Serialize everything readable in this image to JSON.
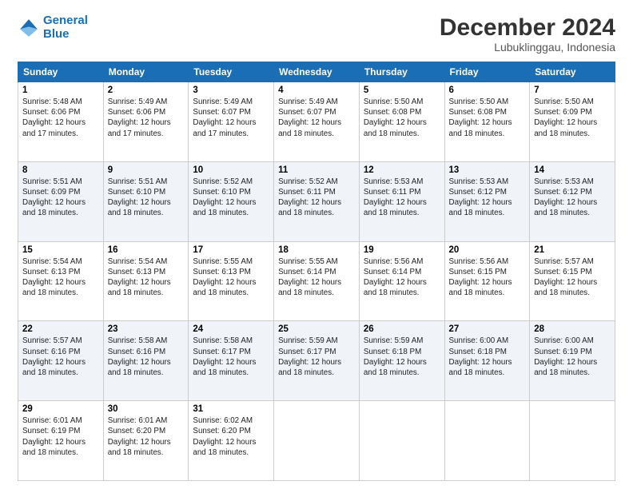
{
  "header": {
    "logo_line1": "General",
    "logo_line2": "Blue",
    "title": "December 2024",
    "subtitle": "Lubuklinggau, Indonesia"
  },
  "days_of_week": [
    "Sunday",
    "Monday",
    "Tuesday",
    "Wednesday",
    "Thursday",
    "Friday",
    "Saturday"
  ],
  "weeks": [
    [
      {
        "day": "1",
        "info": "Sunrise: 5:48 AM\nSunset: 6:06 PM\nDaylight: 12 hours and 17 minutes."
      },
      {
        "day": "2",
        "info": "Sunrise: 5:49 AM\nSunset: 6:06 PM\nDaylight: 12 hours and 17 minutes."
      },
      {
        "day": "3",
        "info": "Sunrise: 5:49 AM\nSunset: 6:07 PM\nDaylight: 12 hours and 17 minutes."
      },
      {
        "day": "4",
        "info": "Sunrise: 5:49 AM\nSunset: 6:07 PM\nDaylight: 12 hours and 18 minutes."
      },
      {
        "day": "5",
        "info": "Sunrise: 5:50 AM\nSunset: 6:08 PM\nDaylight: 12 hours and 18 minutes."
      },
      {
        "day": "6",
        "info": "Sunrise: 5:50 AM\nSunset: 6:08 PM\nDaylight: 12 hours and 18 minutes."
      },
      {
        "day": "7",
        "info": "Sunrise: 5:50 AM\nSunset: 6:09 PM\nDaylight: 12 hours and 18 minutes."
      }
    ],
    [
      {
        "day": "8",
        "info": "Sunrise: 5:51 AM\nSunset: 6:09 PM\nDaylight: 12 hours and 18 minutes."
      },
      {
        "day": "9",
        "info": "Sunrise: 5:51 AM\nSunset: 6:10 PM\nDaylight: 12 hours and 18 minutes."
      },
      {
        "day": "10",
        "info": "Sunrise: 5:52 AM\nSunset: 6:10 PM\nDaylight: 12 hours and 18 minutes."
      },
      {
        "day": "11",
        "info": "Sunrise: 5:52 AM\nSunset: 6:11 PM\nDaylight: 12 hours and 18 minutes."
      },
      {
        "day": "12",
        "info": "Sunrise: 5:53 AM\nSunset: 6:11 PM\nDaylight: 12 hours and 18 minutes."
      },
      {
        "day": "13",
        "info": "Sunrise: 5:53 AM\nSunset: 6:12 PM\nDaylight: 12 hours and 18 minutes."
      },
      {
        "day": "14",
        "info": "Sunrise: 5:53 AM\nSunset: 6:12 PM\nDaylight: 12 hours and 18 minutes."
      }
    ],
    [
      {
        "day": "15",
        "info": "Sunrise: 5:54 AM\nSunset: 6:13 PM\nDaylight: 12 hours and 18 minutes."
      },
      {
        "day": "16",
        "info": "Sunrise: 5:54 AM\nSunset: 6:13 PM\nDaylight: 12 hours and 18 minutes."
      },
      {
        "day": "17",
        "info": "Sunrise: 5:55 AM\nSunset: 6:13 PM\nDaylight: 12 hours and 18 minutes."
      },
      {
        "day": "18",
        "info": "Sunrise: 5:55 AM\nSunset: 6:14 PM\nDaylight: 12 hours and 18 minutes."
      },
      {
        "day": "19",
        "info": "Sunrise: 5:56 AM\nSunset: 6:14 PM\nDaylight: 12 hours and 18 minutes."
      },
      {
        "day": "20",
        "info": "Sunrise: 5:56 AM\nSunset: 6:15 PM\nDaylight: 12 hours and 18 minutes."
      },
      {
        "day": "21",
        "info": "Sunrise: 5:57 AM\nSunset: 6:15 PM\nDaylight: 12 hours and 18 minutes."
      }
    ],
    [
      {
        "day": "22",
        "info": "Sunrise: 5:57 AM\nSunset: 6:16 PM\nDaylight: 12 hours and 18 minutes."
      },
      {
        "day": "23",
        "info": "Sunrise: 5:58 AM\nSunset: 6:16 PM\nDaylight: 12 hours and 18 minutes."
      },
      {
        "day": "24",
        "info": "Sunrise: 5:58 AM\nSunset: 6:17 PM\nDaylight: 12 hours and 18 minutes."
      },
      {
        "day": "25",
        "info": "Sunrise: 5:59 AM\nSunset: 6:17 PM\nDaylight: 12 hours and 18 minutes."
      },
      {
        "day": "26",
        "info": "Sunrise: 5:59 AM\nSunset: 6:18 PM\nDaylight: 12 hours and 18 minutes."
      },
      {
        "day": "27",
        "info": "Sunrise: 6:00 AM\nSunset: 6:18 PM\nDaylight: 12 hours and 18 minutes."
      },
      {
        "day": "28",
        "info": "Sunrise: 6:00 AM\nSunset: 6:19 PM\nDaylight: 12 hours and 18 minutes."
      }
    ],
    [
      {
        "day": "29",
        "info": "Sunrise: 6:01 AM\nSunset: 6:19 PM\nDaylight: 12 hours and 18 minutes."
      },
      {
        "day": "30",
        "info": "Sunrise: 6:01 AM\nSunset: 6:20 PM\nDaylight: 12 hours and 18 minutes."
      },
      {
        "day": "31",
        "info": "Sunrise: 6:02 AM\nSunset: 6:20 PM\nDaylight: 12 hours and 18 minutes."
      },
      null,
      null,
      null,
      null
    ]
  ]
}
